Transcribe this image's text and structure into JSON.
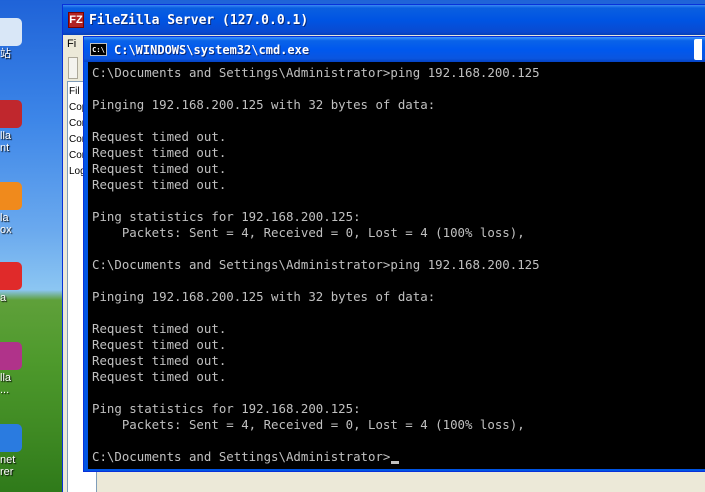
{
  "desktop": {
    "icons": [
      {
        "label": "站",
        "color": "#d9e7f7"
      },
      {
        "label": "lla\nnt",
        "color": "#c0272d"
      },
      {
        "label": "la\nox",
        "color": "#f08a1c"
      },
      {
        "label": "a",
        "color": "#e02a2a"
      },
      {
        "label": "lla\n...",
        "color": "#b0338a"
      },
      {
        "label": "net\nrer",
        "color": "#2a7be0"
      }
    ]
  },
  "filezilla": {
    "title": "FileZilla Server (127.0.0.1)",
    "icon_letter": "FZ",
    "menu_label": "Fi",
    "log_items": [
      "Fil",
      "Cop",
      "Cor",
      "Cor",
      "Cor",
      "Log"
    ]
  },
  "cmd": {
    "title": "C:\\WINDOWS\\system32\\cmd.exe",
    "icon_text": "C:\\",
    "lines": [
      "C:\\Documents and Settings\\Administrator>ping 192.168.200.125",
      "",
      "Pinging 192.168.200.125 with 32 bytes of data:",
      "",
      "Request timed out.",
      "Request timed out.",
      "Request timed out.",
      "Request timed out.",
      "",
      "Ping statistics for 192.168.200.125:",
      "    Packets: Sent = 4, Received = 0, Lost = 4 (100% loss),",
      "",
      "C:\\Documents and Settings\\Administrator>ping 192.168.200.125",
      "",
      "Pinging 192.168.200.125 with 32 bytes of data:",
      "",
      "Request timed out.",
      "Request timed out.",
      "Request timed out.",
      "Request timed out.",
      "",
      "Ping statistics for 192.168.200.125:",
      "    Packets: Sent = 4, Received = 0, Lost = 4 (100% loss),",
      "",
      "C:\\Documents and Settings\\Administrator>"
    ]
  }
}
